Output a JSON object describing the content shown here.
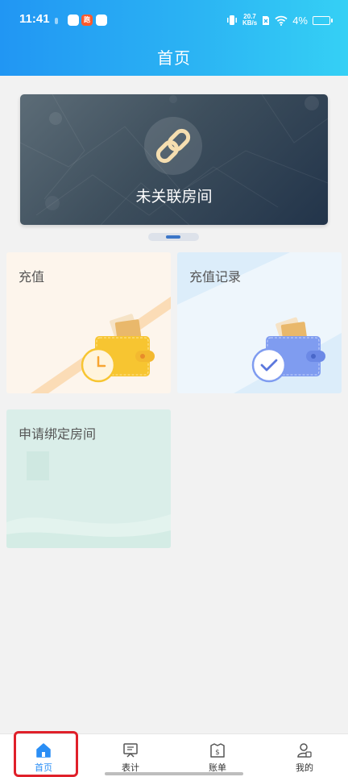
{
  "status_bar": {
    "time": "11:41",
    "app_badge": "跑",
    "net_speed_value": "20.7",
    "net_speed_unit": "KB/s",
    "battery": "4%"
  },
  "header": {
    "title": "首页"
  },
  "banner": {
    "text": "未关联房间",
    "icon": "link-icon"
  },
  "carousel": {
    "active_index": 0
  },
  "cards": {
    "recharge": {
      "label": "充值",
      "icon": "wallet-clock-icon"
    },
    "records": {
      "label": "充值记录",
      "icon": "wallet-check-icon"
    },
    "bind_room": {
      "label": "申请绑定房间"
    }
  },
  "tabbar": {
    "active": "home",
    "items": [
      {
        "label": "首页",
        "icon": "home-icon"
      },
      {
        "label": "表计",
        "icon": "meter-icon"
      },
      {
        "label": "账单",
        "icon": "bill-icon"
      },
      {
        "label": "我的",
        "icon": "profile-icon"
      }
    ]
  },
  "colors": {
    "header_start": "#2196f3",
    "header_end": "#35d0f5",
    "tab_active": "#2a8ef5",
    "highlight_box": "#e0202a"
  }
}
